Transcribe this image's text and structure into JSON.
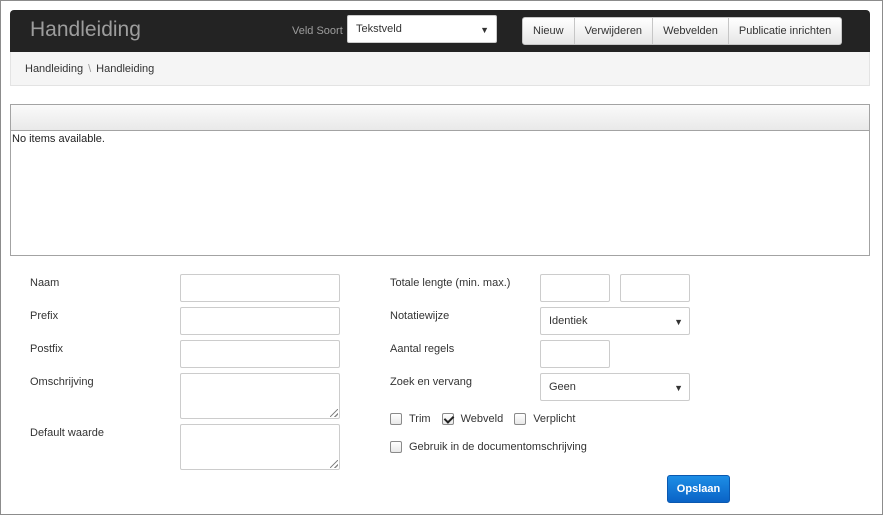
{
  "header": {
    "title": "Handleiding",
    "veld_soort_label": "Veld Soort",
    "veld_soort_value": "Tekstveld",
    "buttons": [
      "Nieuw",
      "Verwijderen",
      "Webvelden",
      "Publicatie inrichten"
    ]
  },
  "breadcrumb": {
    "items": [
      "Handleiding",
      "Handleiding"
    ],
    "separator": "\\"
  },
  "grid": {
    "empty_text": "No items available."
  },
  "form": {
    "naam_label": "Naam",
    "prefix_label": "Prefix",
    "postfix_label": "Postfix",
    "omschrijving_label": "Omschrijving",
    "default_label": "Default waarde",
    "totale_lengte_label": "Totale lengte (min. max.)",
    "notatiewijze_label": "Notatiewijze",
    "notatiewijze_value": "Identiek",
    "aantal_regels_label": "Aantal regels",
    "zoek_vervang_label": "Zoek en vervang",
    "zoek_vervang_value": "Geen",
    "checkboxes": [
      {
        "label": "Trim",
        "checked": false
      },
      {
        "label": "Webveld",
        "checked": true
      },
      {
        "label": "Verplicht",
        "checked": false
      }
    ],
    "gebruik_label": "Gebruik in de documentomschrijving",
    "gebruik_checked": false,
    "save_label": "Opslaan"
  },
  "icons": {
    "select_caret": "caret-down-icon",
    "checkbox_check": "check-icon"
  },
  "colors": {
    "header_bg": "#232323",
    "primary_button": "#0a63c6"
  }
}
